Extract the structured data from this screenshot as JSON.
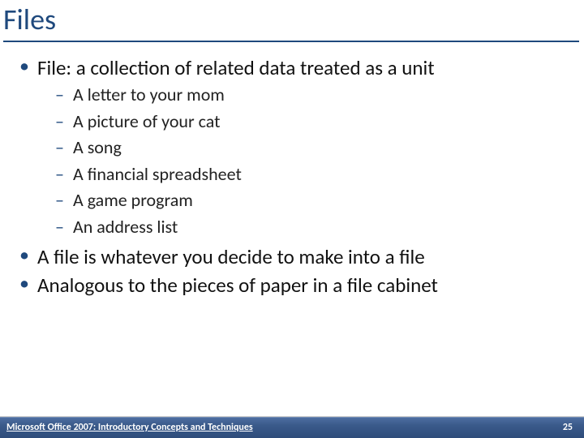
{
  "title": "Files",
  "bullets": {
    "b1": "File:  a collection of related data treated as a unit",
    "sub": [
      "A letter to your mom",
      "A picture of your cat",
      "A song",
      "A financial spreadsheet",
      "A game program",
      "An address list"
    ],
    "b2": "A file is whatever you decide to make into a file",
    "b3": "Analogous to the pieces of paper in a file cabinet"
  },
  "footer": {
    "left": "Microsoft Office 2007: Introductory Concepts and Techniques",
    "page": "25"
  }
}
